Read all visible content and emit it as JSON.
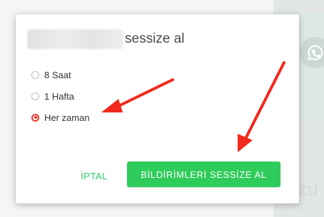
{
  "dialog": {
    "title_suffix": "sessize al",
    "options": [
      {
        "label": "8 Saat",
        "selected": false
      },
      {
        "label": "1 Hafta",
        "selected": false
      },
      {
        "label": "Her zaman",
        "selected": true
      }
    ],
    "cancel_label": "İPTAL",
    "confirm_label": "BİLDİRİMLERİ SESSİZE AL"
  },
  "background": {
    "partial_text": "zu"
  },
  "colors": {
    "accent_green": "#2ecc5a",
    "radio_selected": "#ea3a2c",
    "annotation_arrow": "#f0291c"
  },
  "icons": {
    "background_app": "whatsapp-icon"
  }
}
